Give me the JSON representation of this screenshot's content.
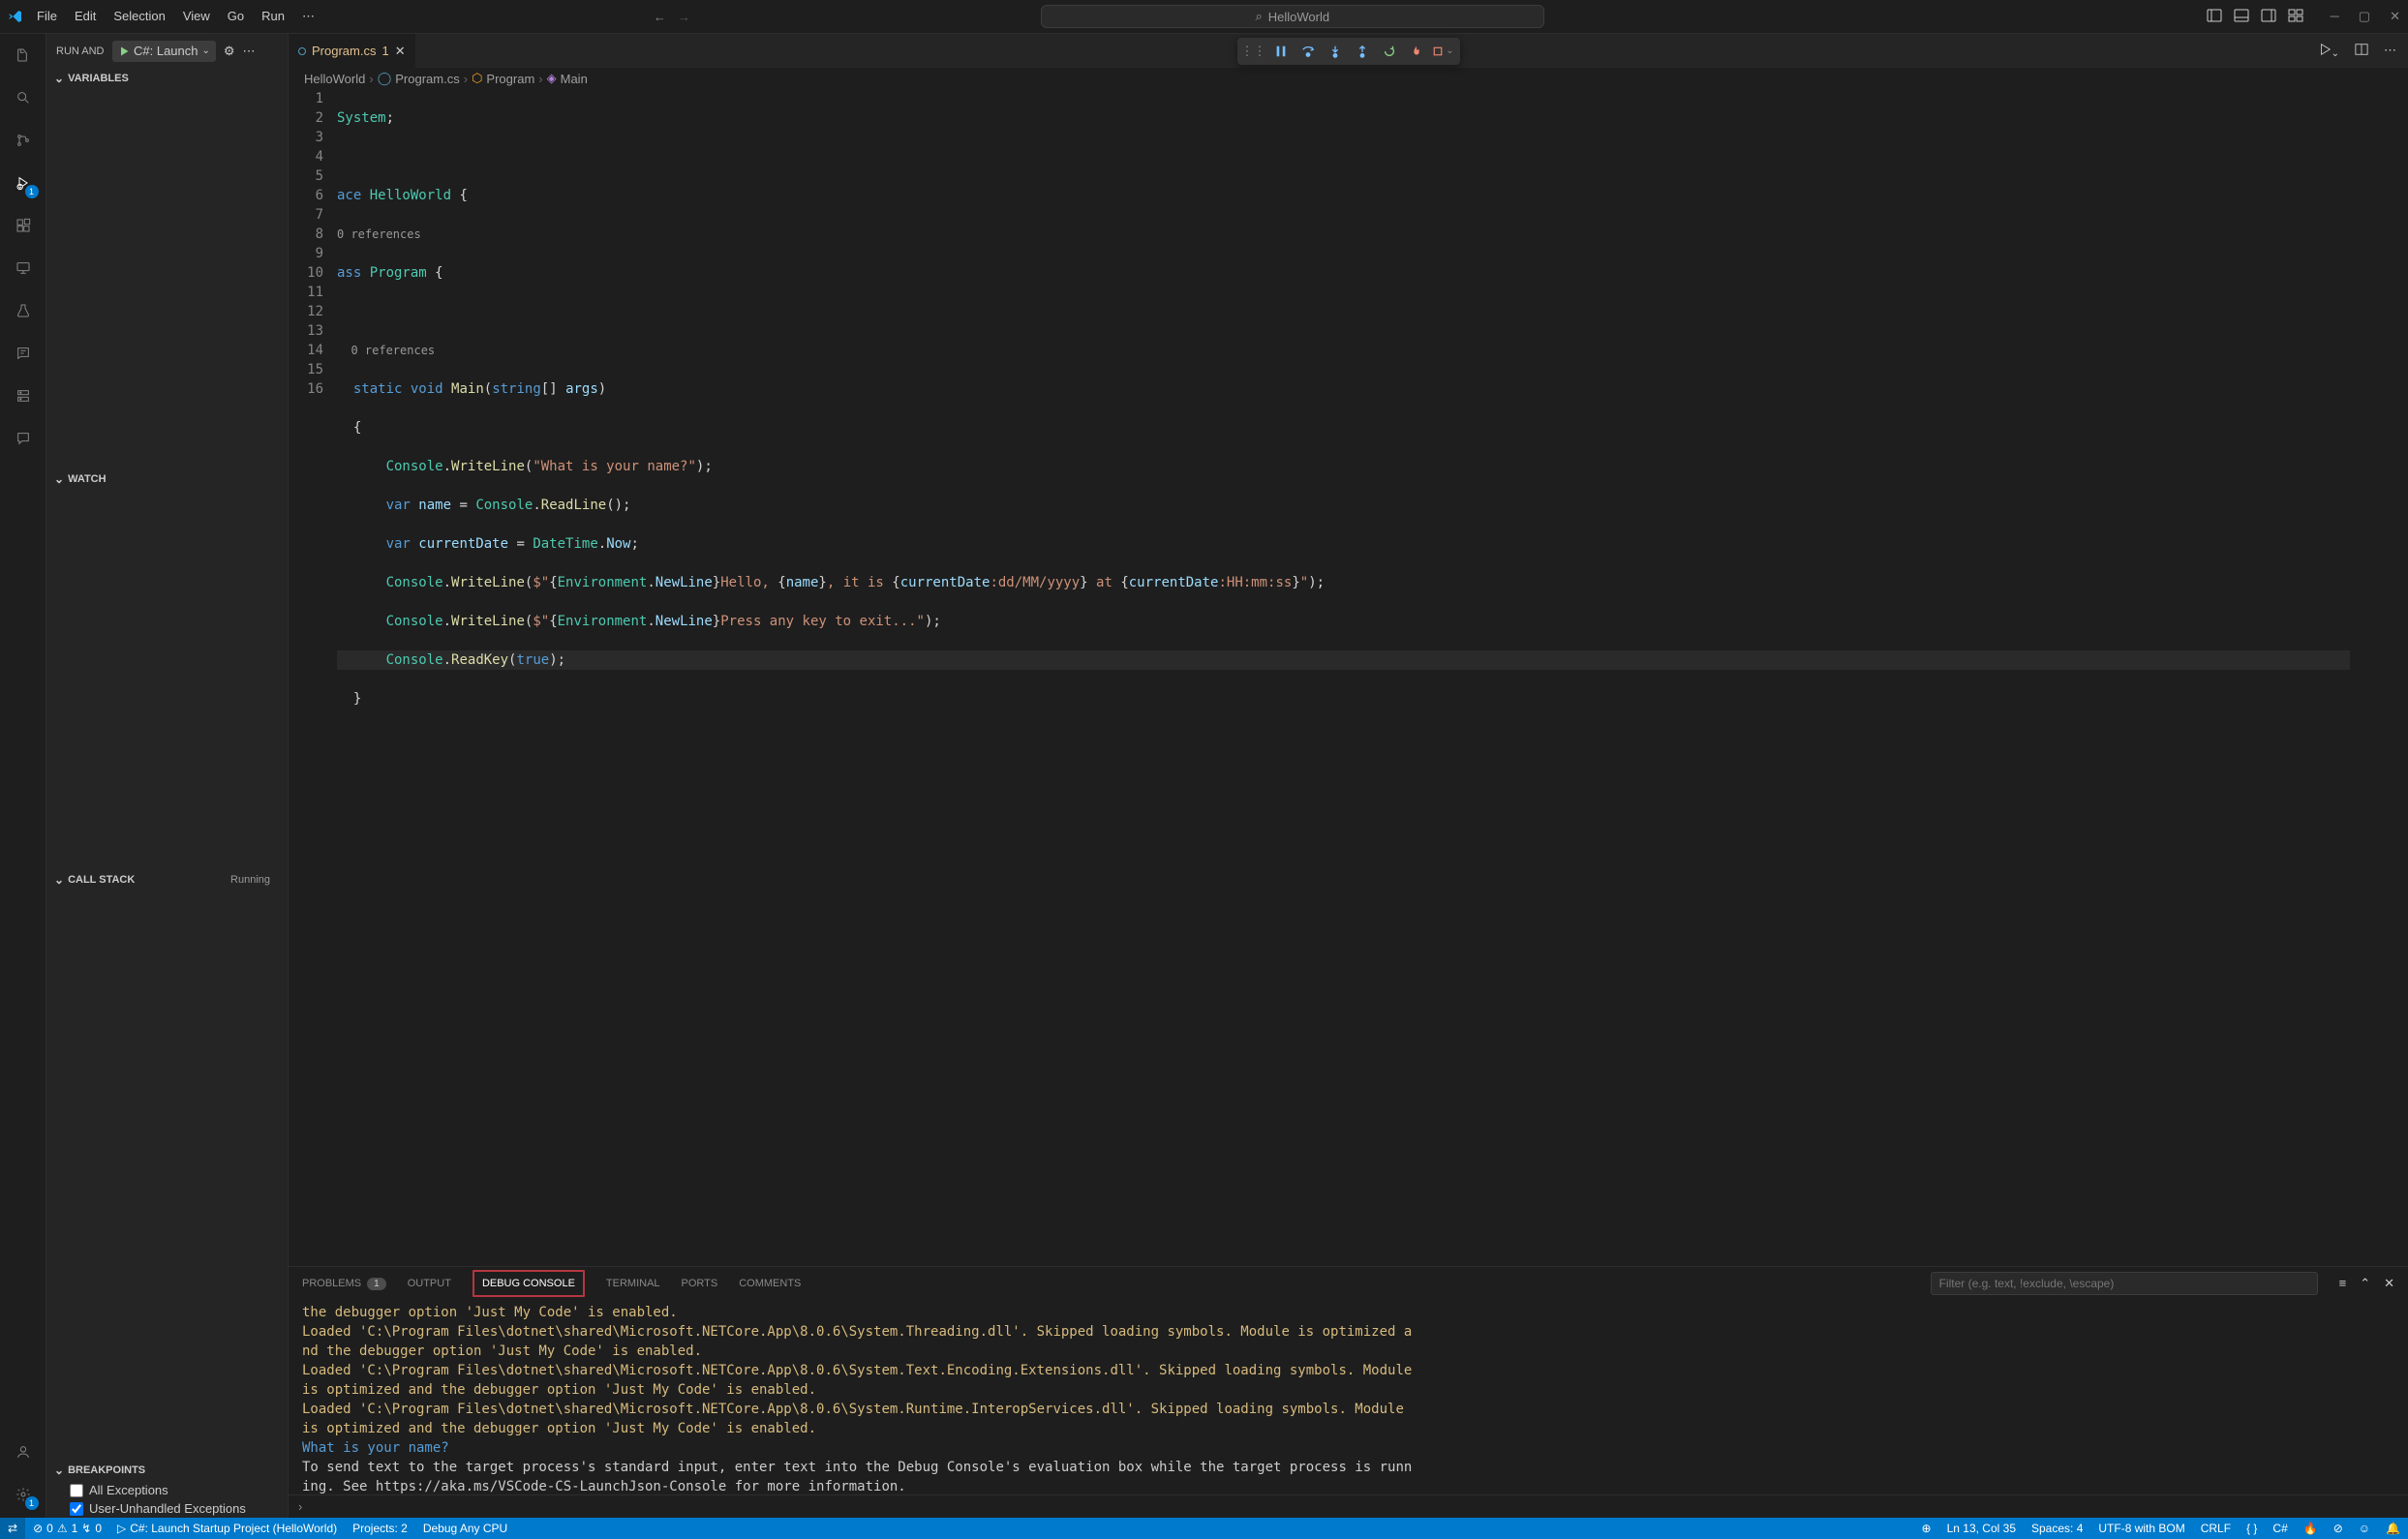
{
  "menu": [
    "File",
    "Edit",
    "Selection",
    "View",
    "Go",
    "Run"
  ],
  "search_text": "HelloWorld",
  "sidebar": {
    "title": "RUN AND DEBUG",
    "launch": "C#: Launch",
    "sections": {
      "variables": "VARIABLES",
      "watch": "WATCH",
      "callstack": "CALL STACK",
      "running": "Running",
      "breakpoints": "BREAKPOINTS"
    },
    "bp": [
      "All Exceptions",
      "User-Unhandled Exceptions"
    ]
  },
  "tab": {
    "name": "Program.cs",
    "mod": "1"
  },
  "breadcrumb": [
    "HelloWorld",
    "Program.cs",
    "Program",
    "Main"
  ],
  "gutter": [
    "1",
    "2",
    "3",
    "",
    "4",
    "5",
    "",
    "6",
    "7",
    "8",
    "9",
    "10",
    "11",
    "12",
    "13",
    "14",
    "15",
    "16"
  ],
  "codelens": "0 references",
  "code": {
    "l1_a": "System",
    "l1_b": ";",
    "l3_a": "ace ",
    "l3_b": "HelloWorld",
    "l3_c": " {",
    "l4_a": "ass ",
    "l4_b": "Program",
    "l4_c": " {",
    "l6_a": "static ",
    "l6_b": "void ",
    "l6_c": "Main",
    "l6_d": "(",
    "l6_e": "string",
    "l6_f": "[] ",
    "l6_g": "args",
    "l6_h": ")",
    "l7": "{",
    "l8_a": "Console",
    "l8_b": ".",
    "l8_c": "WriteLine",
    "l8_d": "(",
    "l8_e": "\"What is your name?\"",
    "l8_f": ");",
    "l9_a": "var ",
    "l9_b": "name",
    "l9_c": " = ",
    "l9_d": "Console",
    "l9_e": ".",
    "l9_f": "ReadLine",
    "l9_g": "();",
    "l10_a": "var ",
    "l10_b": "currentDate",
    "l10_c": " = ",
    "l10_d": "DateTime",
    "l10_e": ".",
    "l10_f": "Now",
    "l10_g": ";",
    "l11_a": "Console",
    "l11_b": ".",
    "l11_c": "WriteLine",
    "l11_d": "(",
    "l11_e": "$\"",
    "l11_f": "{",
    "l11_g": "Environment",
    "l11_h": ".",
    "l11_i": "NewLine",
    "l11_j": "}",
    "l11_k": "Hello, ",
    "l11_l": "{",
    "l11_m": "name",
    "l11_n": "}",
    "l11_o": ", it is ",
    "l11_p": "{",
    "l11_q": "currentDate",
    "l11_r": ":dd/MM/yyyy",
    "l11_s": "}",
    "l11_t": " at ",
    "l11_u": "{",
    "l11_v": "currentDate",
    "l11_w": ":HH:mm:ss",
    "l11_x": "}",
    "l11_y": "\"",
    "l11_z": ");",
    "l12_a": "Console",
    "l12_b": ".",
    "l12_c": "WriteLine",
    "l12_d": "(",
    "l12_e": "$\"",
    "l12_f": "{",
    "l12_g": "Environment",
    "l12_h": ".",
    "l12_i": "NewLine",
    "l12_j": "}",
    "l12_k": "Press any key to exit...\"",
    "l12_l": ");",
    "l13_a": "Console",
    "l13_b": ".",
    "l13_c": "ReadKey",
    "l13_d": "(",
    "l13_e": "true",
    "l13_f": ");",
    "l14": "}"
  },
  "panel": {
    "tabs": {
      "problems": "PROBLEMS",
      "output": "OUTPUT",
      "debug": "DEBUG CONSOLE",
      "terminal": "TERMINAL",
      "ports": "PORTS",
      "comments": "COMMENTS"
    },
    "problems_count": "1",
    "filter_placeholder": "Filter (e.g. text, !exclude, \\escape)",
    "lines": [
      {
        "cls": "yl",
        "t": "the debugger option 'Just My Code' is enabled."
      },
      {
        "cls": "yl",
        "t": "Loaded 'C:\\Program Files\\dotnet\\shared\\Microsoft.NETCore.App\\8.0.6\\System.Threading.dll'. Skipped loading symbols. Module is optimized a"
      },
      {
        "cls": "yl",
        "t": "nd the debugger option 'Just My Code' is enabled."
      },
      {
        "cls": "yl",
        "t": "Loaded 'C:\\Program Files\\dotnet\\shared\\Microsoft.NETCore.App\\8.0.6\\System.Text.Encoding.Extensions.dll'. Skipped loading symbols. Module"
      },
      {
        "cls": "yl",
        "t": "is optimized and the debugger option 'Just My Code' is enabled."
      },
      {
        "cls": "yl",
        "t": "Loaded 'C:\\Program Files\\dotnet\\shared\\Microsoft.NETCore.App\\8.0.6\\System.Runtime.InteropServices.dll'. Skipped loading symbols. Module"
      },
      {
        "cls": "yl",
        "t": "is optimized and the debugger option 'Just My Code' is enabled."
      },
      {
        "cls": "bl",
        "t": "What is your name?"
      },
      {
        "cls": "wt",
        "t": "To send text to the target process's standard input, enter text into the Debug Console's evaluation box while the target process is runn"
      },
      {
        "cls": "wt",
        "t": "ing. See https://aka.ms/VSCode-CS-LaunchJson-Console for more information."
      }
    ]
  },
  "status": {
    "errors": "0",
    "warnings": "1",
    "live": "0",
    "launch": "C#: Launch Startup Project (HelloWorld)",
    "projects": "Projects: 2",
    "config": "Debug Any CPU",
    "pos": "Ln 13, Col 35",
    "spaces": "Spaces: 4",
    "encoding": "UTF-8 with BOM",
    "eol": "CRLF",
    "lang": "C#",
    "braces": "{ }"
  }
}
